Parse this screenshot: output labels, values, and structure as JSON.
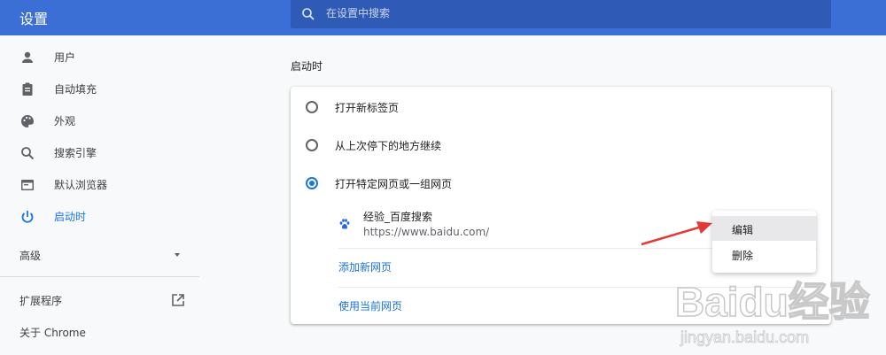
{
  "header": {
    "title": "设置",
    "search_placeholder": "在设置中搜索"
  },
  "sidebar": {
    "items": [
      {
        "label": "用户",
        "icon": "person-icon"
      },
      {
        "label": "自动填充",
        "icon": "clipboard-icon"
      },
      {
        "label": "外观",
        "icon": "palette-icon"
      },
      {
        "label": "搜索引擎",
        "icon": "search-icon"
      },
      {
        "label": "默认浏览器",
        "icon": "browser-icon"
      },
      {
        "label": "启动时",
        "icon": "power-icon",
        "active": true
      }
    ],
    "advanced_label": "高级",
    "extensions_label": "扩展程序",
    "about_label": "关于 Chrome"
  },
  "main": {
    "section_title": "启动时",
    "options": [
      {
        "label": "打开新标签页",
        "checked": false
      },
      {
        "label": "从上次停下的地方继续",
        "checked": false
      },
      {
        "label": "打开特定网页或一组网页",
        "checked": true
      }
    ],
    "site": {
      "name": "经验_百度搜索",
      "url": "https://www.baidu.com/"
    },
    "add_page_label": "添加新网页",
    "use_current_label": "使用当前网页"
  },
  "menu": {
    "edit_label": "编辑",
    "delete_label": "删除"
  },
  "watermark": {
    "brand": "Baidu经验",
    "url": "jingyan.baidu.com"
  },
  "colors": {
    "header_bg": "#3c6fd6",
    "search_bg": "#2f5bb7",
    "accent": "#1a73e8",
    "annotation_arrow": "#e53935"
  }
}
